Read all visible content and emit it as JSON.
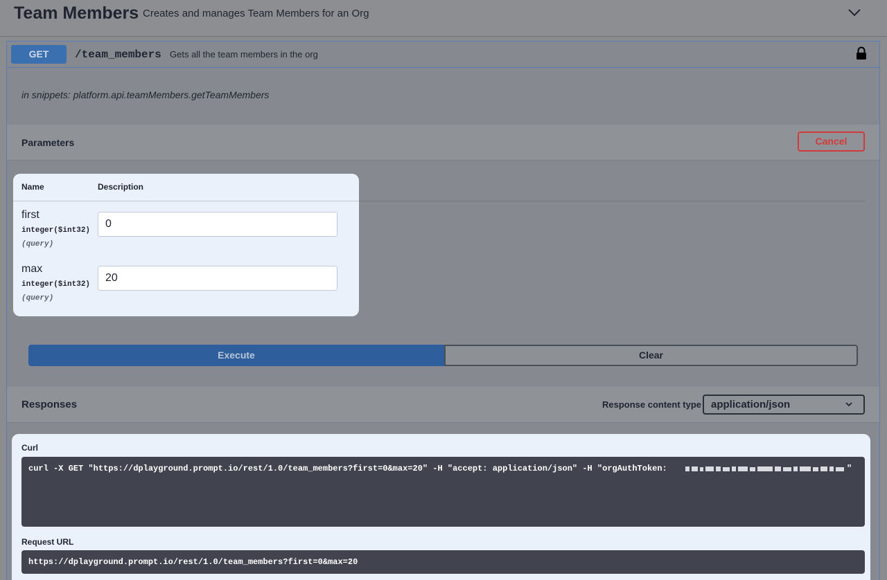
{
  "tag": {
    "title": "Team Members",
    "description": "Creates and manages Team Members for an Org",
    "toggle_icon": "chevron-down-icon"
  },
  "operation": {
    "method": "GET",
    "path": "/team_members",
    "summary": "Gets all the team members in the org",
    "lock_icon": "lock-icon",
    "snippet": "in snippets: platform.api.teamMembers.getTeamMembers"
  },
  "parameters": {
    "title": "Parameters",
    "cancel_label": "Cancel",
    "col_name": "Name",
    "col_description": "Description",
    "items": [
      {
        "name": "first",
        "type": "integer($int32)",
        "in": "(query)",
        "value": "0"
      },
      {
        "name": "max",
        "type": "integer($int32)",
        "in": "(query)",
        "value": "20"
      }
    ]
  },
  "actions": {
    "execute_label": "Execute",
    "clear_label": "Clear"
  },
  "responses": {
    "title": "Responses",
    "content_type_label": "Response content type",
    "content_type_value": "application/json",
    "curl_label": "Curl",
    "curl_command": "curl -X GET \"https://dplayground.prompt.io/rest/1.0/team_members?first=0&max=20\" -H \"accept: application/json\" -H \"orgAuthToken: ",
    "curl_end": "\"",
    "request_url_label": "Request URL",
    "request_url": "https://dplayground.prompt.io/rest/1.0/team_members?first=0&max=20"
  },
  "colors": {
    "get_method": "#3a6fb0",
    "execute": "#2f5e9c",
    "cancel": "#d23a3a",
    "highlight_panel": "#eaf1fa",
    "code_bg": "#41444e"
  }
}
